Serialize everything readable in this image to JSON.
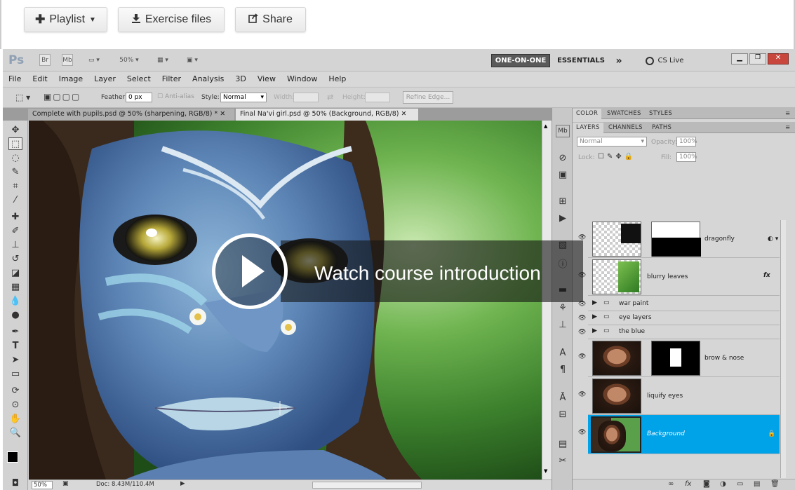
{
  "top_buttons": {
    "playlist": "Playlist",
    "exercise": "Exercise files",
    "share": "Share"
  },
  "app": {
    "logo": "Ps",
    "bridge": "Br",
    "minibridge": "Mb",
    "zoom": "50%",
    "workspace_active": "ONE-ON-ONE",
    "workspace_other": "ESSENTIALS",
    "more": "»",
    "cslive": "CS Live"
  },
  "menu": [
    "File",
    "Edit",
    "Image",
    "Layer",
    "Select",
    "Filter",
    "Analysis",
    "3D",
    "View",
    "Window",
    "Help"
  ],
  "options": {
    "feather_label": "Feather:",
    "feather_value": "0 px",
    "antialias": "Anti-alias",
    "style_label": "Style:",
    "style_value": "Normal",
    "width_label": "Width:",
    "height_label": "Height:",
    "refine": "Refine Edge..."
  },
  "doc_tabs": [
    {
      "label": "Complete with pupils.psd @ 50% (sharpening, RGB/8) *"
    },
    {
      "label": "Final Na'vi girl.psd @ 50% (Background, RGB/8)"
    }
  ],
  "status": {
    "zoom": "50%",
    "doc": "Doc: 8.43M/110.4M"
  },
  "panel_tabs_top": [
    "COLOR",
    "SWATCHES",
    "STYLES"
  ],
  "panel_tabs_layers": [
    "LAYERS",
    "CHANNELS",
    "PATHS"
  ],
  "layer_controls": {
    "blend": "Normal",
    "opacity_label": "Opacity:",
    "opacity": "100%",
    "lock_label": "Lock:",
    "fill_label": "Fill:",
    "fill": "100%"
  },
  "layers": [
    {
      "name": "dragonfly"
    },
    {
      "name": "blurry leaves",
      "fx": "fx"
    },
    {
      "name": "war paint"
    },
    {
      "name": "eye layers"
    },
    {
      "name": "the blue"
    },
    {
      "name": "brow & nose"
    },
    {
      "name": "liquify eyes"
    },
    {
      "name": "Background"
    }
  ],
  "overlay_text": "Watch course introduction",
  "colors": {
    "selected_layer": "#00a2e8",
    "workspace_active_bg": "#5a5a5a"
  }
}
